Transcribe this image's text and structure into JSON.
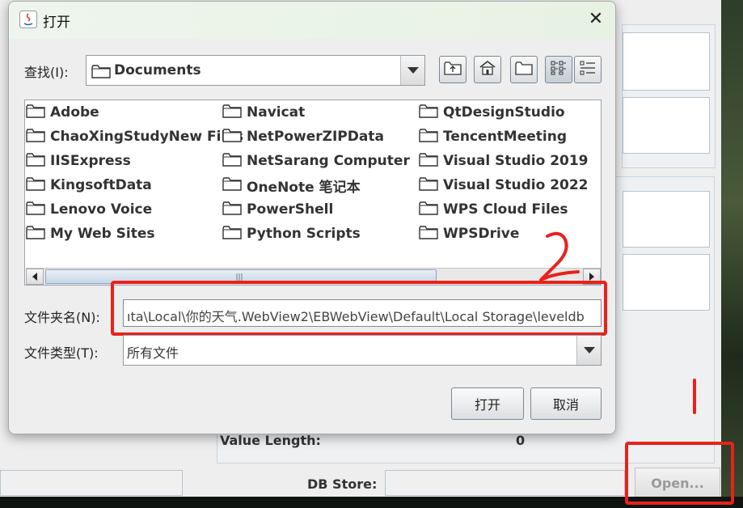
{
  "dialog": {
    "title": "打开",
    "look_in_label": "查找(I):",
    "look_in_value": "Documents",
    "filename_label": "文件夹名(N):",
    "filename_value": "ıta\\Local\\你的天气.WebView2\\EBWebView\\Default\\Local Storage\\leveldb",
    "filetype_label": "文件类型(T):",
    "filetype_value": "所有文件",
    "open_button": "打开",
    "cancel_button": "取消",
    "toolbar_icons": [
      "up-folder-icon",
      "home-icon",
      "new-folder-icon",
      "list-view-icon",
      "details-view-icon"
    ],
    "files": [
      [
        "Adobe",
        "ChaoXingStudyNew Files",
        "IISExpress",
        "KingsoftData",
        "Lenovo Voice",
        "My Web Sites"
      ],
      [
        "Navicat",
        "NetPowerZIPData",
        "NetSarang Computer",
        "OneNote 笔记本",
        "PowerShell",
        "Python Scripts"
      ],
      [
        "QtDesignStudio",
        "TencentMeeting",
        "Visual Studio 2019",
        "Visual Studio 2022",
        "WPS Cloud Files",
        "WPSDrive"
      ]
    ]
  },
  "background": {
    "value_length_label": "Value Length:",
    "value_length_value": "0",
    "db_store_label": "DB Store:",
    "open_button": "Open..."
  },
  "annotations": {
    "mark1": "1",
    "mark2": "2",
    "color": "#e8221b"
  }
}
